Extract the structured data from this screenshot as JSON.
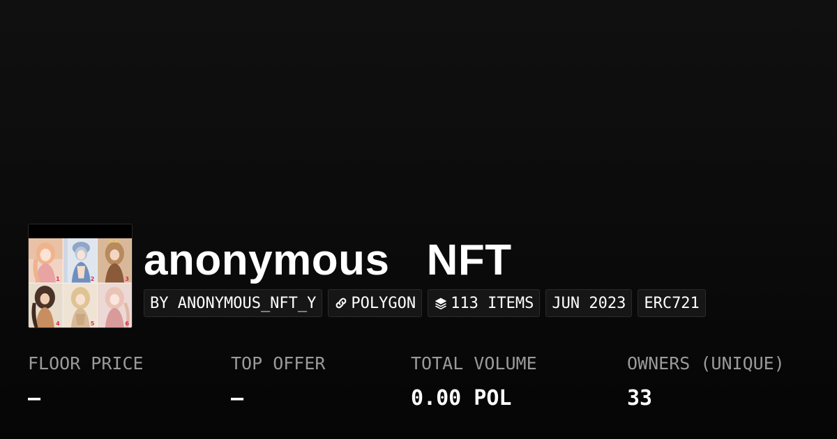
{
  "collection": {
    "name": "anonymous   NFT",
    "thumbnail": {
      "numbers": [
        "1",
        "2",
        "3",
        "4",
        "5",
        "6"
      ]
    }
  },
  "tags": {
    "creator": "BY ANONYMOUS_NFT_Y",
    "chain": "POLYGON",
    "items": "113 ITEMS",
    "date": "JUN 2023",
    "standard": "ERC721"
  },
  "icons": {
    "chain": "link-icon",
    "items": "layers-icon"
  },
  "stats": {
    "floor_price": {
      "label": "FLOOR PRICE",
      "value": "–"
    },
    "top_offer": {
      "label": "TOP OFFER",
      "value": "–"
    },
    "total_volume": {
      "label": "TOTAL VOLUME",
      "value": "0.00 POL"
    },
    "owners": {
      "label": "OWNERS (UNIQUE)",
      "value": "33"
    }
  },
  "colors": {
    "background": "#0b0b0b",
    "text": "#ffffff",
    "muted_label": "#9a9a9a",
    "tag_background": "#161616",
    "tag_border": "#2b2b2b"
  }
}
